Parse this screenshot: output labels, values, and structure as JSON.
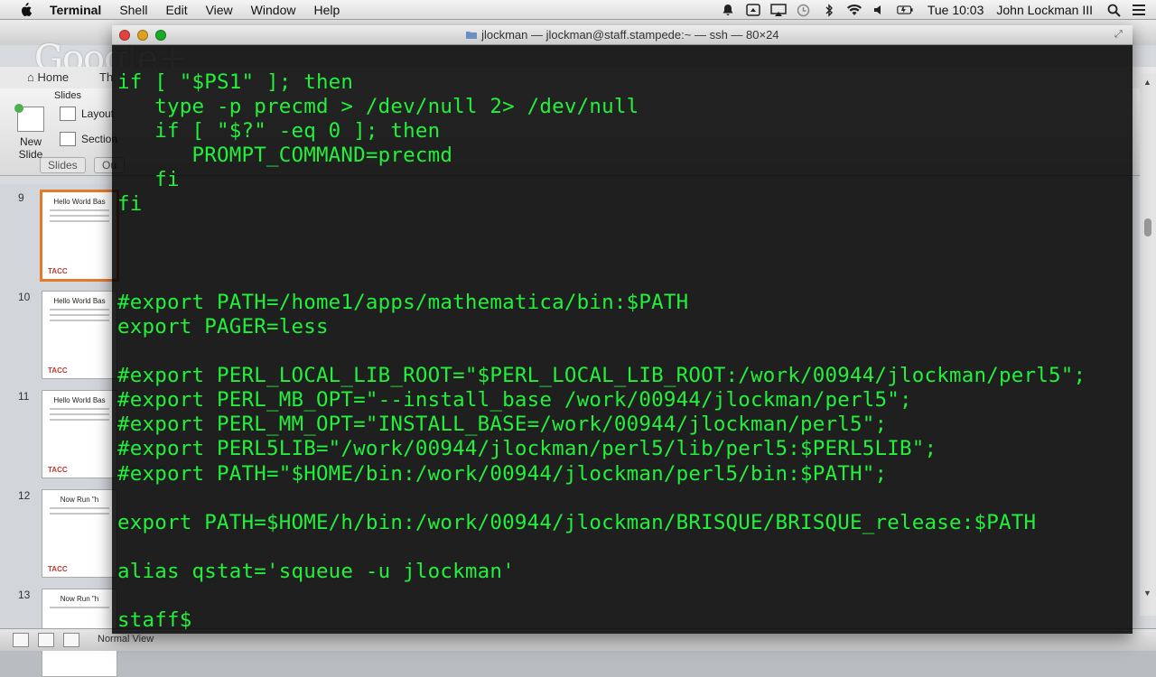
{
  "menubar": {
    "app_name": "Terminal",
    "items": [
      "Shell",
      "Edit",
      "View",
      "Window",
      "Help"
    ],
    "clock": "Tue 10:03",
    "user": "John Lockman III",
    "status_icons": [
      "bell-icon",
      "screen-share-icon",
      "airplay-icon",
      "time-machine-icon",
      "bluetooth-icon",
      "wifi-icon",
      "volume-icon",
      "battery-icon",
      "search-icon",
      "list-icon"
    ]
  },
  "background_app": {
    "overlay_brand": "Google+",
    "ribbon_tabs": [
      "Home",
      "Th"
    ],
    "ribbon": {
      "group_label": "Slides",
      "new_slide_label": "New Slide",
      "layout_label": "Layout",
      "section_label": "Section"
    },
    "view_tabs": [
      "Slides",
      "Ou"
    ],
    "thumbnails": [
      {
        "number": "9",
        "title": "Hello World Bas",
        "selected": true
      },
      {
        "number": "10",
        "title": "Hello World Bas",
        "selected": false
      },
      {
        "number": "11",
        "title": "Hello World Bas",
        "selected": false
      },
      {
        "number": "12",
        "title": "Now Run \"h",
        "selected": false
      },
      {
        "number": "13",
        "title": "Now Run \"h",
        "selected": false
      }
    ],
    "thumb_logo": "TACC",
    "status_label": "Normal View"
  },
  "terminal": {
    "title": "jlockman — jlockman@staff.stampede:~ — ssh — 80×24",
    "lines": [
      "if [ \"$PS1\" ]; then",
      "   type -p precmd > /dev/null 2> /dev/null",
      "   if [ \"$?\" -eq 0 ]; then",
      "      PROMPT_COMMAND=precmd",
      "   fi",
      "fi",
      "",
      "",
      "",
      "#export PATH=/home1/apps/mathematica/bin:$PATH",
      "export PAGER=less",
      "",
      "#export PERL_LOCAL_LIB_ROOT=\"$PERL_LOCAL_LIB_ROOT:/work/00944/jlockman/perl5\";",
      "#export PERL_MB_OPT=\"--install_base /work/00944/jlockman/perl5\";",
      "#export PERL_MM_OPT=\"INSTALL_BASE=/work/00944/jlockman/perl5\";",
      "#export PERL5LIB=\"/work/00944/jlockman/perl5/lib/perl5:$PERL5LIB\";",
      "#export PATH=\"$HOME/bin:/work/00944/jlockman/perl5/bin:$PATH\";",
      "",
      "export PATH=$HOME/h/bin:/work/00944/jlockman/BRISQUE/BRISQUE_release:$PATH",
      "",
      "alias qstat='squeue -u jlockman'",
      "",
      "staff$ "
    ]
  }
}
